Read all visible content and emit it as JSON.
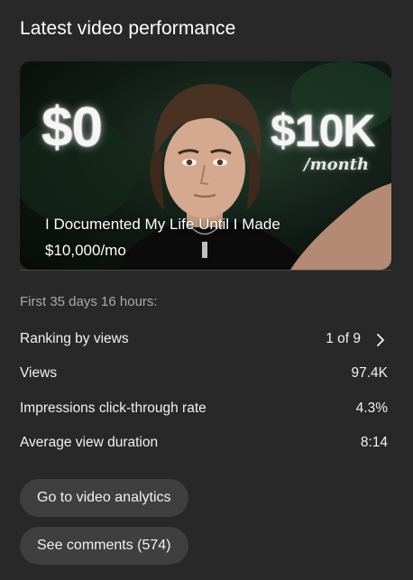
{
  "card": {
    "title": "Latest video performance"
  },
  "video": {
    "title": "I Documented My Life Until I Made $10,000/mo",
    "thumbnail": {
      "left_text": "$0",
      "right_text": "$10K",
      "right_subtext": "/month"
    }
  },
  "period_label": "First 35 days 16 hours:",
  "metrics": [
    {
      "label": "Ranking by views",
      "value": "1 of 9"
    },
    {
      "label": "Views",
      "value": "97.4K"
    },
    {
      "label": "Impressions click-through rate",
      "value": "4.3%"
    },
    {
      "label": "Average view duration",
      "value": "8:14"
    }
  ],
  "buttons": {
    "analytics": "Go to video analytics",
    "comments": "See comments (574)"
  },
  "colors": {
    "background": "#282828",
    "button": "#3f3f3f",
    "secondary_text": "#aaaaaa"
  }
}
